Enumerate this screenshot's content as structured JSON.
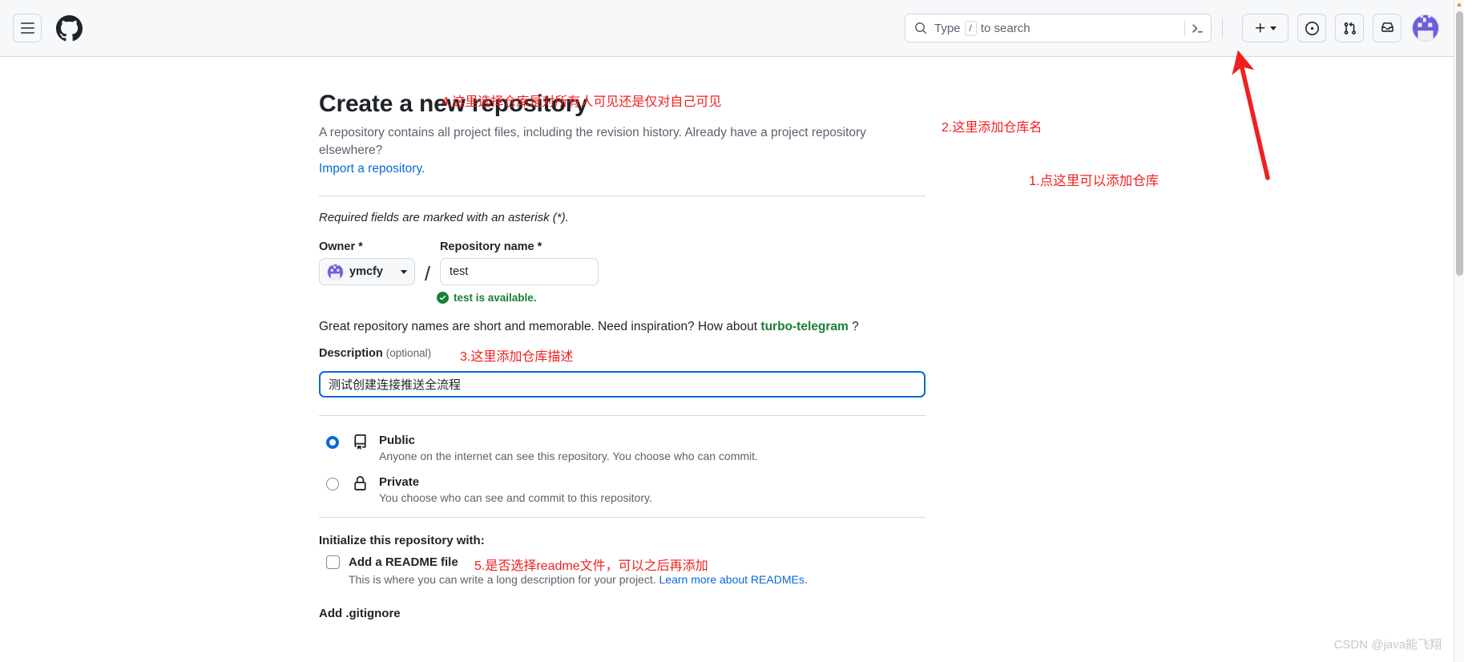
{
  "header": {
    "menu_icon": "hamburger-icon",
    "logo_icon": "github-logo-icon",
    "search": {
      "placeholder_prefix": "Type",
      "slash_key": "/",
      "placeholder_suffix": "to search",
      "search_icon": "search-icon",
      "command_icon": "terminal-prompt-icon"
    },
    "actions": [
      {
        "name": "create-new-button",
        "icon": "plus-icon"
      },
      {
        "name": "issues-button",
        "icon": "issue-opened-icon"
      },
      {
        "name": "pull-requests-button",
        "icon": "git-pull-request-icon"
      },
      {
        "name": "notifications-button",
        "icon": "inbox-icon"
      },
      {
        "name": "user-avatar-button",
        "icon": "avatar-identicon"
      }
    ]
  },
  "page": {
    "title": "Create a new repository",
    "lede_text": "A repository contains all project files, including the revision history. Already have a project repository elsewhere?",
    "import_link": "Import a repository.",
    "required_note": "Required fields are marked with an asterisk (*)."
  },
  "owner": {
    "label": "Owner *",
    "value": "ymcfy"
  },
  "repo_name": {
    "label": "Repository name *",
    "value": "test",
    "availability": "test is available.",
    "available_icon": "check-circle-fill-icon"
  },
  "name_hint": {
    "before": "Great repository names are short and memorable. Need inspiration? How about",
    "suggestion": "turbo-telegram",
    "after": "?"
  },
  "description": {
    "label": "Description",
    "optional": "(optional)",
    "value": "测试创建连接推送全流程"
  },
  "visibility": {
    "public": {
      "name": "Public",
      "description": "Anyone on the internet can see this repository. You choose who can commit.",
      "icon": "repo-book-icon",
      "selected": true
    },
    "private": {
      "name": "Private",
      "description": "You choose who can see and commit to this repository.",
      "icon": "lock-icon",
      "selected": false
    }
  },
  "initialize": {
    "heading": "Initialize this repository with:",
    "readme_label": "Add a README file",
    "readme_checked": false,
    "readme_desc": "This is where you can write a long description for your project.",
    "readme_link": "Learn more about READMEs.",
    "gitignore_heading": "Add .gitignore"
  },
  "annotations": {
    "a1": "1.点这里可以添加仓库",
    "a2": "2.这里添加仓库名",
    "a3": "3.这里添加仓库描述",
    "a4": "4.这里选择仓库是对所有人可见还是仅对自己可见",
    "a5": "5.是否选择readme文件，可以之后再添加"
  },
  "watermark": "CSDN @java能飞翔",
  "colors": {
    "annotation_red": "#f02020",
    "link_blue": "#0969da",
    "success_green": "#1a7f37",
    "avatar_purple": "#6e5ce0",
    "header_bg": "#f6f8fa",
    "border": "#d1d9e0"
  }
}
